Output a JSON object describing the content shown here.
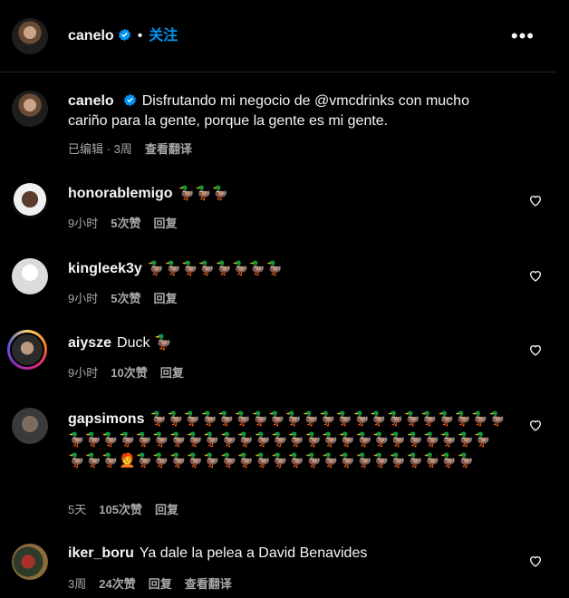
{
  "header": {
    "username": "canelo",
    "follow_label": "关注",
    "separator": "•",
    "more_label": "•••"
  },
  "caption": {
    "username": "canelo",
    "text": "Disfrutando mi negocio de @vmcdrinks con mucho cariño para la gente, porque la gente es mi gente.",
    "edited": "已编辑",
    "time": "3周",
    "translate": "查看翻译"
  },
  "comments": [
    {
      "username": "honorablemigo",
      "text": "🦆🦆🦆",
      "time": "9小时",
      "likes": "5次赞",
      "reply": "回复"
    },
    {
      "username": "kingleek3y",
      "text": "🦆🦆🦆🦆🦆🦆🦆🦆",
      "time": "9小时",
      "likes": "5次赞",
      "reply": "回复"
    },
    {
      "username": "aiysze",
      "text": "Duck 🦆",
      "time": "9小时",
      "likes": "10次赞",
      "reply": "回复"
    },
    {
      "username": "gapsimons",
      "text": "🦆🦆🦆🦆🦆🦆🦆🦆🦆🦆🦆🦆🦆🦆🦆🦆🦆🦆🦆🦆🦆🦆🦆🦆🦆🦆🦆🦆🦆🦆🦆🦆🦆🦆🦆🦆🦆🦆🦆🦆🦆🦆🦆🦆🦆🦆🦆🦆🦆🧑‍🦰🦆🦆🦆🦆🦆🦆🦆🦆🦆🦆🦆🦆🦆🦆🦆🦆🦆🦆🦆🦆",
      "time": "5天",
      "likes": "105次赞",
      "reply": "回复"
    },
    {
      "username": "iker_boru",
      "text": "Ya dale la pelea a David Benavides",
      "time": "3周",
      "likes": "24次赞",
      "reply": "回复",
      "translate": "查看翻译"
    }
  ],
  "colors": {
    "accent": "#0095f6",
    "muted": "#a8a8a8",
    "background": "#000000",
    "text": "#f5f5f5"
  }
}
